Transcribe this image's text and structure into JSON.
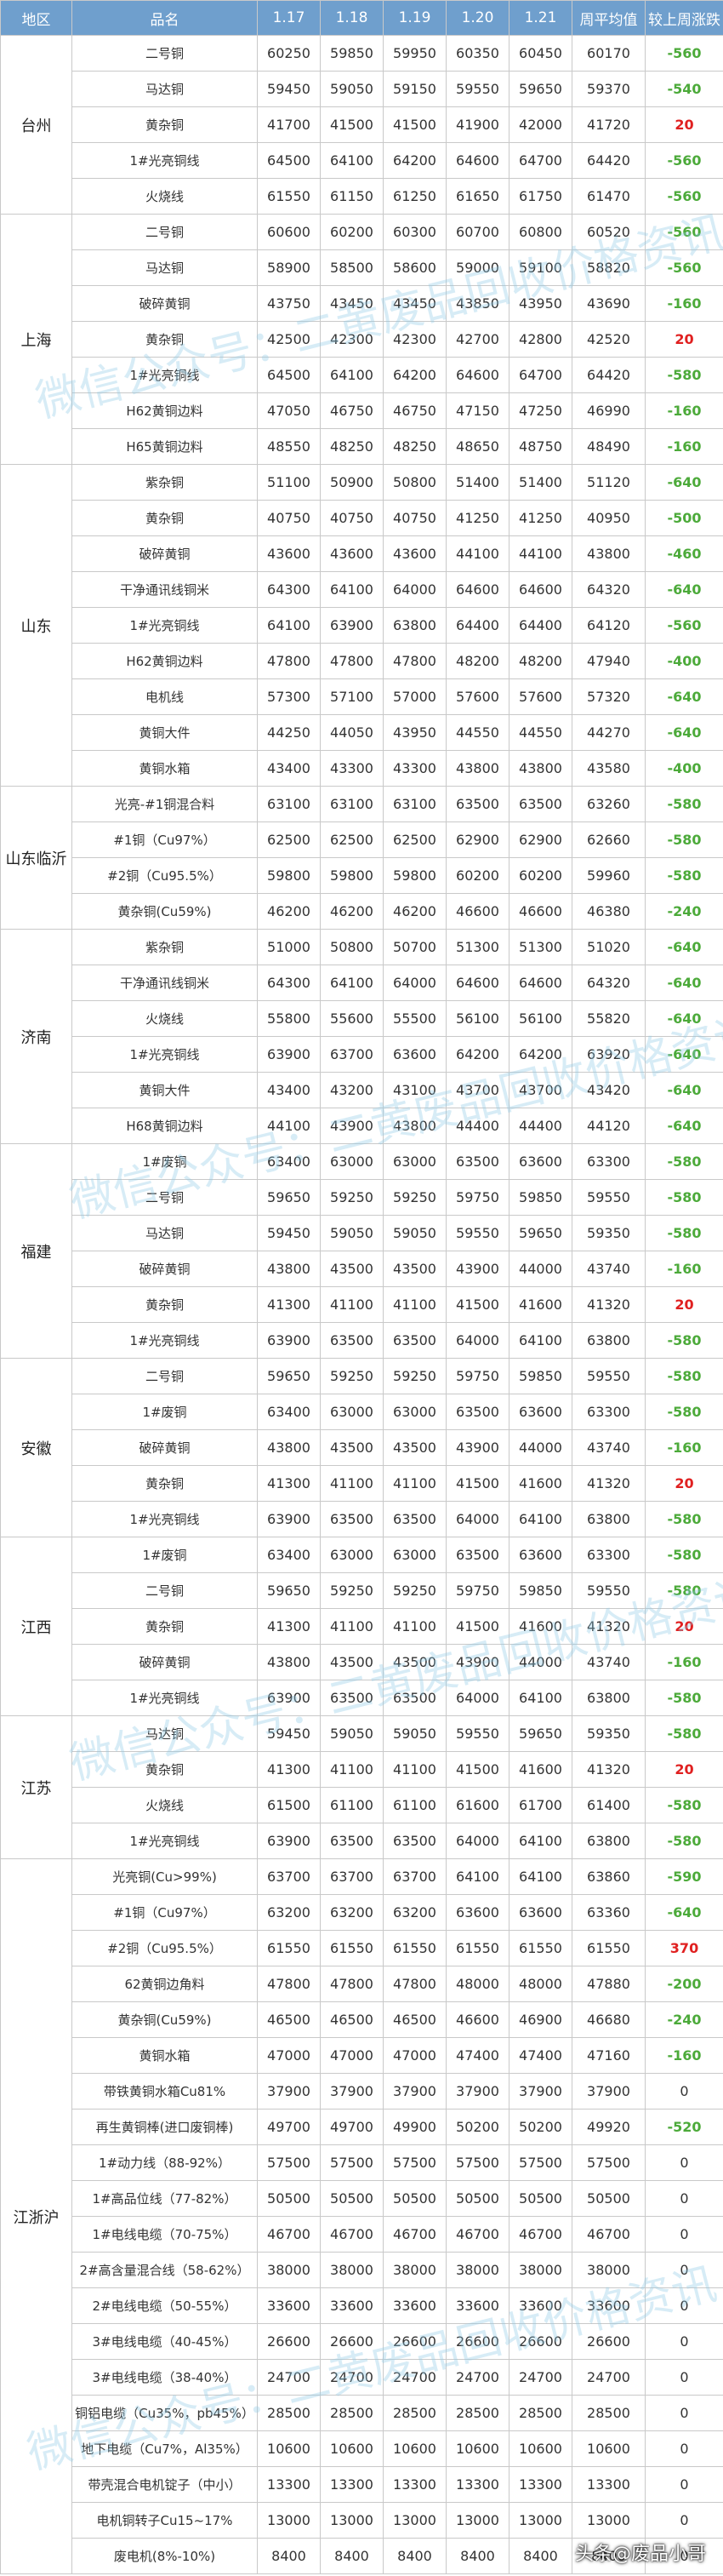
{
  "header": [
    "地区",
    "品名",
    "1.17",
    "1.18",
    "1.19",
    "1.20",
    "1.21",
    "周平均值",
    "较上周涨跌"
  ],
  "regions": [
    {
      "name": "台州",
      "rows": [
        {
          "item": "二号铜",
          "v": [
            "60250",
            "59850",
            "59950",
            "60350",
            "60450"
          ],
          "avg": "60170",
          "chg": "-560"
        },
        {
          "item": "马达铜",
          "v": [
            "59450",
            "59050",
            "59150",
            "59550",
            "59650"
          ],
          "avg": "59370",
          "chg": "-540"
        },
        {
          "item": "黄杂铜",
          "v": [
            "41700",
            "41500",
            "41500",
            "41900",
            "42000"
          ],
          "avg": "41720",
          "chg": "20"
        },
        {
          "item": "1#光亮铜线",
          "v": [
            "64500",
            "64100",
            "64200",
            "64600",
            "64700"
          ],
          "avg": "64420",
          "chg": "-560"
        },
        {
          "item": "火烧线",
          "v": [
            "61550",
            "61150",
            "61250",
            "61650",
            "61750"
          ],
          "avg": "61470",
          "chg": "-560"
        }
      ]
    },
    {
      "name": "上海",
      "rows": [
        {
          "item": "二号铜",
          "v": [
            "60600",
            "60200",
            "60300",
            "60700",
            "60800"
          ],
          "avg": "60520",
          "chg": "-560"
        },
        {
          "item": "马达铜",
          "v": [
            "58900",
            "58500",
            "58600",
            "59000",
            "59100"
          ],
          "avg": "58820",
          "chg": "-560"
        },
        {
          "item": "破碎黄铜",
          "v": [
            "43750",
            "43450",
            "43450",
            "43850",
            "43950"
          ],
          "avg": "43690",
          "chg": "-160"
        },
        {
          "item": "黄杂铜",
          "v": [
            "42500",
            "42300",
            "42300",
            "42700",
            "42800"
          ],
          "avg": "42520",
          "chg": "20"
        },
        {
          "item": "1#光亮铜线",
          "v": [
            "64500",
            "64100",
            "64200",
            "64600",
            "64700"
          ],
          "avg": "64420",
          "chg": "-580"
        },
        {
          "item": "H62黄铜边料",
          "v": [
            "47050",
            "46750",
            "46750",
            "47150",
            "47250"
          ],
          "avg": "46990",
          "chg": "-160"
        },
        {
          "item": "H65黄铜边料",
          "v": [
            "48550",
            "48250",
            "48250",
            "48650",
            "48750"
          ],
          "avg": "48490",
          "chg": "-160"
        }
      ]
    },
    {
      "name": "山东",
      "rows": [
        {
          "item": "紫杂铜",
          "v": [
            "51100",
            "50900",
            "50800",
            "51400",
            "51400"
          ],
          "avg": "51120",
          "chg": "-640"
        },
        {
          "item": "黄杂铜",
          "v": [
            "40750",
            "40750",
            "40750",
            "41250",
            "41250"
          ],
          "avg": "40950",
          "chg": "-500"
        },
        {
          "item": "破碎黄铜",
          "v": [
            "43600",
            "43600",
            "43600",
            "44100",
            "44100"
          ],
          "avg": "43800",
          "chg": "-460"
        },
        {
          "item": "干净通讯线铜米",
          "v": [
            "64300",
            "64100",
            "64000",
            "64600",
            "64600"
          ],
          "avg": "64320",
          "chg": "-640"
        },
        {
          "item": "1#光亮铜线",
          "v": [
            "64100",
            "63900",
            "63800",
            "64400",
            "64400"
          ],
          "avg": "64120",
          "chg": "-560"
        },
        {
          "item": "H62黄铜边料",
          "v": [
            "47800",
            "47800",
            "47800",
            "48200",
            "48200"
          ],
          "avg": "47940",
          "chg": "-400"
        },
        {
          "item": "电机线",
          "v": [
            "57300",
            "57100",
            "57000",
            "57600",
            "57600"
          ],
          "avg": "57320",
          "chg": "-640"
        },
        {
          "item": "黄铜大件",
          "v": [
            "44250",
            "44050",
            "43950",
            "44550",
            "44550"
          ],
          "avg": "44270",
          "chg": "-640"
        },
        {
          "item": "黄铜水箱",
          "v": [
            "43400",
            "43300",
            "43300",
            "43800",
            "43800"
          ],
          "avg": "43580",
          "chg": "-400"
        }
      ]
    },
    {
      "name": "山东临沂",
      "rows": [
        {
          "item": "光亮-#1铜混合料",
          "v": [
            "63100",
            "63100",
            "63100",
            "63500",
            "63500"
          ],
          "avg": "63260",
          "chg": "-580"
        },
        {
          "item": "#1铜（Cu97%）",
          "v": [
            "62500",
            "62500",
            "62500",
            "62900",
            "62900"
          ],
          "avg": "62660",
          "chg": "-580"
        },
        {
          "item": "#2铜（Cu95.5%）",
          "v": [
            "59800",
            "59800",
            "59800",
            "60200",
            "60200"
          ],
          "avg": "59960",
          "chg": "-580"
        },
        {
          "item": "黄杂铜(Cu59%)",
          "v": [
            "46200",
            "46200",
            "46200",
            "46600",
            "46600"
          ],
          "avg": "46380",
          "chg": "-240"
        }
      ]
    },
    {
      "name": "济南",
      "rows": [
        {
          "item": "紫杂铜",
          "v": [
            "51000",
            "50800",
            "50700",
            "51300",
            "51300"
          ],
          "avg": "51020",
          "chg": "-640"
        },
        {
          "item": "干净通讯线铜米",
          "v": [
            "64300",
            "64100",
            "64000",
            "64600",
            "64600"
          ],
          "avg": "64320",
          "chg": "-640"
        },
        {
          "item": "火烧线",
          "v": [
            "55800",
            "55600",
            "55500",
            "56100",
            "56100"
          ],
          "avg": "55820",
          "chg": "-640"
        },
        {
          "item": "1#光亮铜线",
          "v": [
            "63900",
            "63700",
            "63600",
            "64200",
            "64200"
          ],
          "avg": "63920",
          "chg": "-640"
        },
        {
          "item": "黄铜大件",
          "v": [
            "43400",
            "43200",
            "43100",
            "43700",
            "43700"
          ],
          "avg": "43420",
          "chg": "-640"
        },
        {
          "item": "H68黄铜边料",
          "v": [
            "44100",
            "43900",
            "43800",
            "44400",
            "44400"
          ],
          "avg": "44120",
          "chg": "-640"
        }
      ]
    },
    {
      "name": "福建",
      "rows": [
        {
          "item": "1#废铜",
          "v": [
            "63400",
            "63000",
            "63000",
            "63500",
            "63600"
          ],
          "avg": "63300",
          "chg": "-580"
        },
        {
          "item": "二号铜",
          "v": [
            "59650",
            "59250",
            "59250",
            "59750",
            "59850"
          ],
          "avg": "59550",
          "chg": "-580"
        },
        {
          "item": "马达铜",
          "v": [
            "59450",
            "59050",
            "59050",
            "59550",
            "59650"
          ],
          "avg": "59350",
          "chg": "-580"
        },
        {
          "item": "破碎黄铜",
          "v": [
            "43800",
            "43500",
            "43500",
            "43900",
            "44000"
          ],
          "avg": "43740",
          "chg": "-160"
        },
        {
          "item": "黄杂铜",
          "v": [
            "41300",
            "41100",
            "41100",
            "41500",
            "41600"
          ],
          "avg": "41320",
          "chg": "20"
        },
        {
          "item": "1#光亮铜线",
          "v": [
            "63900",
            "63500",
            "63500",
            "64000",
            "64100"
          ],
          "avg": "63800",
          "chg": "-580"
        }
      ]
    },
    {
      "name": "安徽",
      "rows": [
        {
          "item": "二号铜",
          "v": [
            "59650",
            "59250",
            "59250",
            "59750",
            "59850"
          ],
          "avg": "59550",
          "chg": "-580"
        },
        {
          "item": "1#废铜",
          "v": [
            "63400",
            "63000",
            "63000",
            "63500",
            "63600"
          ],
          "avg": "63300",
          "chg": "-580"
        },
        {
          "item": "破碎黄铜",
          "v": [
            "43800",
            "43500",
            "43500",
            "43900",
            "44000"
          ],
          "avg": "43740",
          "chg": "-160"
        },
        {
          "item": "黄杂铜",
          "v": [
            "41300",
            "41100",
            "41100",
            "41500",
            "41600"
          ],
          "avg": "41320",
          "chg": "20"
        },
        {
          "item": "1#光亮铜线",
          "v": [
            "63900",
            "63500",
            "63500",
            "64000",
            "64100"
          ],
          "avg": "63800",
          "chg": "-580"
        }
      ]
    },
    {
      "name": "江西",
      "rows": [
        {
          "item": "1#废铜",
          "v": [
            "63400",
            "63000",
            "63000",
            "63500",
            "63600"
          ],
          "avg": "63300",
          "chg": "-580"
        },
        {
          "item": "二号铜",
          "v": [
            "59650",
            "59250",
            "59250",
            "59750",
            "59850"
          ],
          "avg": "59550",
          "chg": "-580"
        },
        {
          "item": "黄杂铜",
          "v": [
            "41300",
            "41100",
            "41100",
            "41500",
            "41600"
          ],
          "avg": "41320",
          "chg": "20"
        },
        {
          "item": "破碎黄铜",
          "v": [
            "43800",
            "43500",
            "43500",
            "43900",
            "44000"
          ],
          "avg": "43740",
          "chg": "-160"
        },
        {
          "item": "1#光亮铜线",
          "v": [
            "63900",
            "63500",
            "63500",
            "64000",
            "64100"
          ],
          "avg": "63800",
          "chg": "-580"
        }
      ]
    },
    {
      "name": "江苏",
      "rows": [
        {
          "item": "马达铜",
          "v": [
            "59450",
            "59050",
            "59050",
            "59550",
            "59650"
          ],
          "avg": "59350",
          "chg": "-580"
        },
        {
          "item": "黄杂铜",
          "v": [
            "41300",
            "41100",
            "41100",
            "41500",
            "41600"
          ],
          "avg": "41320",
          "chg": "20"
        },
        {
          "item": "火烧线",
          "v": [
            "61500",
            "61100",
            "61100",
            "61600",
            "61700"
          ],
          "avg": "61400",
          "chg": "-580"
        },
        {
          "item": "1#光亮铜线",
          "v": [
            "63900",
            "63500",
            "63500",
            "64000",
            "64100"
          ],
          "avg": "63800",
          "chg": "-580"
        }
      ]
    },
    {
      "name": "江浙沪",
      "rows": [
        {
          "item": "光亮铜(Cu>99%)",
          "v": [
            "63700",
            "63700",
            "63700",
            "64100",
            "64100"
          ],
          "avg": "63860",
          "chg": "-590"
        },
        {
          "item": "#1铜（Cu97%）",
          "v": [
            "63200",
            "63200",
            "63200",
            "63600",
            "63600"
          ],
          "avg": "63360",
          "chg": "-640"
        },
        {
          "item": "#2铜（Cu95.5%）",
          "v": [
            "61550",
            "61550",
            "61550",
            "61550",
            "61550"
          ],
          "avg": "61550",
          "chg": "370"
        },
        {
          "item": "62黄铜边角料",
          "v": [
            "47800",
            "47800",
            "47800",
            "48000",
            "48000"
          ],
          "avg": "47880",
          "chg": "-200"
        },
        {
          "item": "黄杂铜(Cu59%)",
          "v": [
            "46500",
            "46500",
            "46500",
            "46600",
            "46900"
          ],
          "avg": "46680",
          "chg": "-240"
        },
        {
          "item": "黄铜水箱",
          "v": [
            "47000",
            "47000",
            "47000",
            "47400",
            "47400"
          ],
          "avg": "47160",
          "chg": "-160"
        },
        {
          "item": "带铁黄铜水箱Cu81%",
          "v": [
            "37900",
            "37900",
            "37900",
            "37900",
            "37900"
          ],
          "avg": "37900",
          "chg": "0"
        },
        {
          "item": "再生黄铜棒(进口废铜棒)",
          "v": [
            "49700",
            "49700",
            "49900",
            "50200",
            "50200"
          ],
          "avg": "49920",
          "chg": "-520"
        },
        {
          "item": "1#动力线（88-92%）",
          "v": [
            "57500",
            "57500",
            "57500",
            "57500",
            "57500"
          ],
          "avg": "57500",
          "chg": "0"
        },
        {
          "item": "1#高品位线（77-82%）",
          "v": [
            "50500",
            "50500",
            "50500",
            "50500",
            "50500"
          ],
          "avg": "50500",
          "chg": "0"
        },
        {
          "item": "1#电线电缆（70-75%）",
          "v": [
            "46700",
            "46700",
            "46700",
            "46700",
            "46700"
          ],
          "avg": "46700",
          "chg": "0"
        },
        {
          "item": "2#高含量混合线（58-62%）",
          "v": [
            "38000",
            "38000",
            "38000",
            "38000",
            "38000"
          ],
          "avg": "38000",
          "chg": "0"
        },
        {
          "item": "2#电线电缆（50-55%）",
          "v": [
            "33600",
            "33600",
            "33600",
            "33600",
            "33600"
          ],
          "avg": "33600",
          "chg": "0"
        },
        {
          "item": "3#电线电缆（40-45%）",
          "v": [
            "26600",
            "26600",
            "26600",
            "26600",
            "26600"
          ],
          "avg": "26600",
          "chg": "0"
        },
        {
          "item": "3#电线电缆（38-40%）",
          "v": [
            "24700",
            "24700",
            "24700",
            "24700",
            "24700"
          ],
          "avg": "24700",
          "chg": "0"
        },
        {
          "item": "铜铝电缆（Cu35%，pb45%）",
          "v": [
            "28500",
            "28500",
            "28500",
            "28500",
            "28500"
          ],
          "avg": "28500",
          "chg": "0"
        },
        {
          "item": "地下电缆（Cu7%，Al35%）",
          "v": [
            "10600",
            "10600",
            "10600",
            "10600",
            "10600"
          ],
          "avg": "10600",
          "chg": "0"
        },
        {
          "item": "带壳混合电机锭子（中小）",
          "v": [
            "13300",
            "13300",
            "13300",
            "13300",
            "13300"
          ],
          "avg": "13300",
          "chg": "0"
        },
        {
          "item": "电机铜转子Cu15~17%",
          "v": [
            "13000",
            "13000",
            "13000",
            "13000",
            "13000"
          ],
          "avg": "13000",
          "chg": "0"
        },
        {
          "item": "废电机(8%-10%)",
          "v": [
            "8400",
            "8400",
            "8400",
            "8400",
            "8400"
          ],
          "avg": "8400",
          "chg": "0"
        }
      ]
    }
  ],
  "watermark": "微信公众号：二黄废品回收价格资讯",
  "credit": "头条@废品小哥",
  "colors": {
    "header_bg": "#6f9fcd",
    "negative": "#4caa3a",
    "positive": "#e02020"
  }
}
